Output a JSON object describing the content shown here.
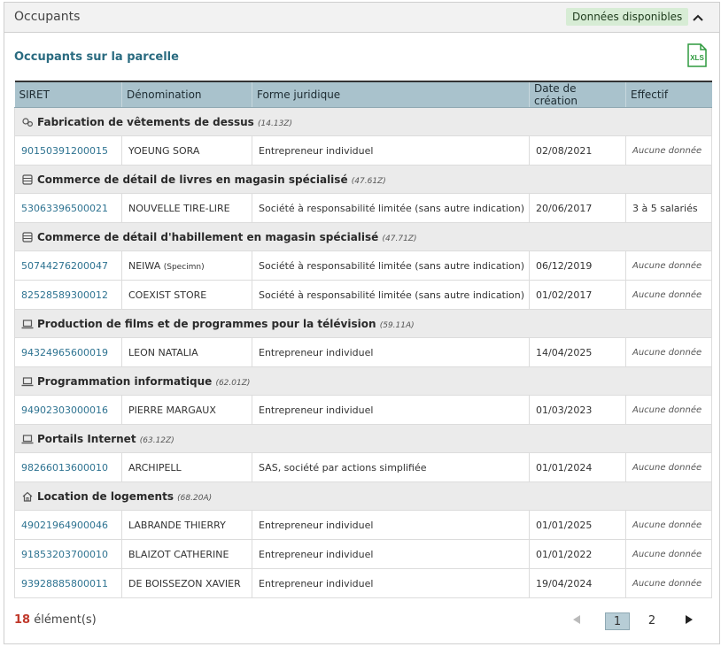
{
  "header": {
    "title": "Occupants",
    "badge": "Données disponibles",
    "collapse_icon": "chevron-up-icon"
  },
  "section": {
    "title": "Occupants sur la parcelle",
    "export_label": "XLS"
  },
  "table": {
    "columns": [
      "SIRET",
      "Dénomination",
      "Forme juridique",
      "Date de création",
      "Effectif"
    ],
    "groups": [
      {
        "icon": "gears-icon",
        "label": "Fabrication de vêtements de dessus",
        "code": "(14.13Z)",
        "rows": [
          {
            "siret": "90150391200015",
            "name": "YOEUNG SORA",
            "form": "Entrepreneur individuel",
            "date": "02/08/2021",
            "staff": "Aucune donnée"
          }
        ]
      },
      {
        "icon": "store-icon",
        "label": "Commerce de détail de livres en magasin spécialisé",
        "code": "(47.61Z)",
        "rows": [
          {
            "siret": "53063396500021",
            "name": "NOUVELLE TIRE-LIRE",
            "form": "Société à responsabilité limitée (sans autre indication)",
            "date": "20/06/2017",
            "staff": "3 à 5 salariés"
          }
        ]
      },
      {
        "icon": "store-icon",
        "label": "Commerce de détail d'habillement en magasin spécialisé",
        "code": "(47.71Z)",
        "rows": [
          {
            "siret": "50744276200047",
            "name": "NEIWA",
            "name_suffix": "(Specimn)",
            "form": "Société à responsabilité limitée (sans autre indication)",
            "date": "06/12/2019",
            "staff": "Aucune donnée"
          },
          {
            "siret": "82528589300012",
            "name": "COEXIST STORE",
            "form": "Société à responsabilité limitée (sans autre indication)",
            "date": "01/02/2017",
            "staff": "Aucune donnée"
          }
        ]
      },
      {
        "icon": "laptop-icon",
        "label": "Production de films et de programmes pour la télévision",
        "code": "(59.11A)",
        "rows": [
          {
            "siret": "94324965600019",
            "name": "LEON NATALIA",
            "form": "Entrepreneur individuel",
            "date": "14/04/2025",
            "staff": "Aucune donnée"
          }
        ]
      },
      {
        "icon": "laptop-icon",
        "label": "Programmation informatique",
        "code": "(62.01Z)",
        "rows": [
          {
            "siret": "94902303000016",
            "name": "PIERRE MARGAUX",
            "form": "Entrepreneur individuel",
            "date": "01/03/2023",
            "staff": "Aucune donnée"
          }
        ]
      },
      {
        "icon": "laptop-icon",
        "label": "Portails Internet",
        "code": "(63.12Z)",
        "rows": [
          {
            "siret": "98266013600010",
            "name": "ARCHIPELL",
            "form": "SAS, société par actions simplifiée",
            "date": "01/01/2024",
            "staff": "Aucune donnée"
          }
        ]
      },
      {
        "icon": "house-icon",
        "label": "Location de logements",
        "code": "(68.20A)",
        "rows": [
          {
            "siret": "49021964900046",
            "name": "LABRANDE THIERRY",
            "form": "Entrepreneur individuel",
            "date": "01/01/2025",
            "staff": "Aucune donnée"
          },
          {
            "siret": "91853203700010",
            "name": "BLAIZOT CATHERINE",
            "form": "Entrepreneur individuel",
            "date": "01/01/2022",
            "staff": "Aucune donnée"
          },
          {
            "siret": "93928885800011",
            "name": "DE BOISSEZON XAVIER",
            "form": "Entrepreneur individuel",
            "date": "19/04/2024",
            "staff": "Aucune donnée"
          }
        ]
      }
    ]
  },
  "footer": {
    "count": "18",
    "count_label": "élément(s)",
    "pages": [
      "1",
      "2"
    ],
    "current_page": "1",
    "prev_icon": "triangle-left-icon",
    "next_icon": "triangle-right-icon"
  },
  "colors": {
    "accent": "#2a6b80",
    "link": "#2e7391",
    "badge_bg": "#d7ecd5",
    "header_row": "#a9c2cc",
    "count": "#c0392b"
  }
}
